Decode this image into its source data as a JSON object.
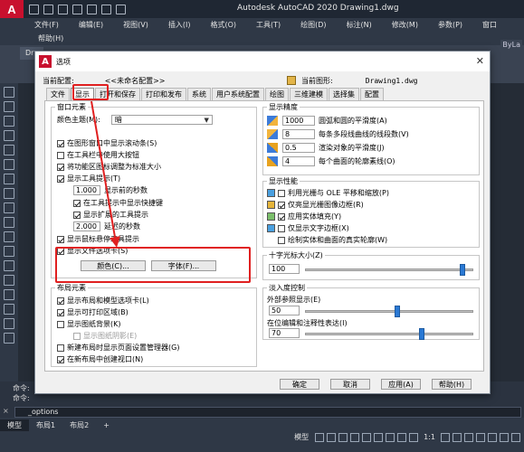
{
  "app": {
    "logo": "A",
    "title": "Autodesk AutoCAD 2020    Drawing1.dwg"
  },
  "menu": {
    "row1": [
      "文件(F)",
      "编辑(E)",
      "视图(V)",
      "插入(I)",
      "格式(O)",
      "工具(T)",
      "绘图(D)",
      "标注(N)",
      "修改(M)",
      "参数(P)",
      "窗口"
    ],
    "row2": [
      "帮助(H)"
    ]
  },
  "doc_tab": "Dra",
  "bylayer": "ByLa",
  "dialog": {
    "logo": "A",
    "title": "选项",
    "close": "✕",
    "profile_label": "当前配置:",
    "profile_value": "<<未命名配置>>",
    "drawing_label": "当前图形:",
    "drawing_value": "Drawing1.dwg",
    "tabs": [
      "文件",
      "显示",
      "打开和保存",
      "打印和发布",
      "系统",
      "用户系统配置",
      "绘图",
      "三维建模",
      "选择集",
      "配置"
    ],
    "window_elements": {
      "title": "窗口元素",
      "theme_label": "颜色主题(M):",
      "theme_value": "暗",
      "scrollbars": "在图形窗口中显示滚动条(S)",
      "large_buttons": "在工具栏中使用大按钮",
      "ribbon_icons": "将功能区图标调整为标准大小",
      "tooltips": "显示工具提示(T)",
      "delay_value": "1.000",
      "delay_label": "显示前的秒数",
      "shortcut_keys": "在工具提示中显示快捷键",
      "extended_tips": "显示扩展的工具提示",
      "ext_delay_value": "2.000",
      "ext_delay_label": "延迟的秒数",
      "rollover": "显示鼠标悬停工具提示",
      "file_tabs": "显示文件选项卡(S)",
      "colors_btn": "颜色(C)...",
      "fonts_btn": "字体(F)..."
    },
    "layout_elements": {
      "title": "布局元素",
      "layout_tabs": "显示布局和模型选项卡(L)",
      "printable_area": "显示可打印区域(B)",
      "paper_bg": "显示图纸背景(K)",
      "paper_shadow": "显示图纸阴影(E)",
      "page_setup": "新建布局时显示页面设置管理器(G)",
      "create_viewport": "在新布局中创建视口(N)"
    },
    "display_resolution": {
      "title": "显示精度",
      "items": [
        {
          "value": "1000",
          "label": "圆弧和圆的平滑度(A)"
        },
        {
          "value": "8",
          "label": "每条多段线曲线的线段数(V)"
        },
        {
          "value": "0.5",
          "label": "渲染对象的平滑度(J)"
        },
        {
          "value": "4",
          "label": "每个曲面的轮廓素线(O)"
        }
      ]
    },
    "display_performance": {
      "title": "显示性能",
      "ole": "利用光栅与 OLE 平移和缩放(P)",
      "raster_frame": "仅亮显光栅图像边框(R)",
      "solid_fill": "应用实体填充(Y)",
      "text_boundary": "仅显示文字边框(X)",
      "true_silhouettes": "绘制实体和曲面的真实轮廓(W)"
    },
    "crosshair": {
      "title": "十字光标大小(Z)",
      "value": "100",
      "fraction": 0.95
    },
    "fade": {
      "title": "淡入度控制",
      "xref_label": "外部参照显示(E)",
      "xref_value": "50",
      "xref_fraction": 0.55,
      "inplace_label": "在位编辑和注释性表达(I)",
      "inplace_value": "70",
      "inplace_fraction": 0.7
    },
    "buttons": [
      "确定",
      "取消",
      "应用(A)",
      "帮助(H)"
    ]
  },
  "command": {
    "line1": "命令:",
    "line2": "命令:",
    "input": "_options",
    "prompt_icon": "×"
  },
  "status": {
    "tabs": [
      "模型",
      "布局1",
      "布局2",
      "+"
    ],
    "model_label": "模型",
    "scale": "1:1"
  },
  "annotation_color": "#e02020"
}
